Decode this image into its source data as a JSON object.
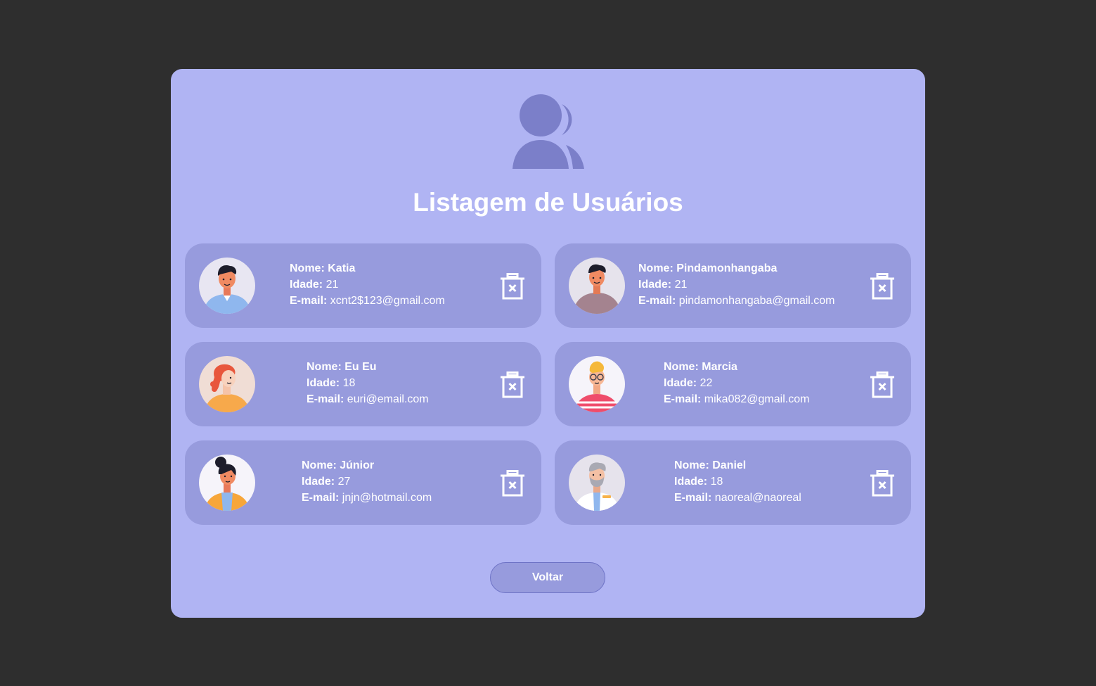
{
  "page": {
    "title": "Listagem de Usuários",
    "header_icon": "users-icon",
    "back_button_label": "Voltar"
  },
  "labels": {
    "name": "Nome:",
    "age": "Idade:",
    "email": "E-mail:"
  },
  "users": [
    {
      "name": "Katia",
      "age": "21",
      "email": "xcnt2$123@gmail.com",
      "avatar": "man-blue-shirt-avatar"
    },
    {
      "name": "Pindamonhangaba",
      "age": "21",
      "email": "pindamonhangaba@gmail.com",
      "avatar": "man-mauve-sweater-avatar"
    },
    {
      "name": "Eu Eu",
      "age": "18",
      "email": "euri@email.com",
      "avatar": "woman-red-hair-avatar"
    },
    {
      "name": "Marcia",
      "age": "22",
      "email": "mika082@gmail.com",
      "avatar": "man-glasses-striped-avatar"
    },
    {
      "name": "Júnior",
      "age": "27",
      "email": "jnjn@hotmail.com",
      "avatar": "woman-bun-avatar"
    },
    {
      "name": "Daniel",
      "age": "18",
      "email": "naoreal@naoreal",
      "avatar": "old-man-doctor-avatar"
    }
  ],
  "delete_icon": "trash-x-icon",
  "colors": {
    "background": "#2e2e2e",
    "panel": "#b0b4f3",
    "card": "#979bdd",
    "icon": "#7b7fc9",
    "text": "#ffffff"
  }
}
